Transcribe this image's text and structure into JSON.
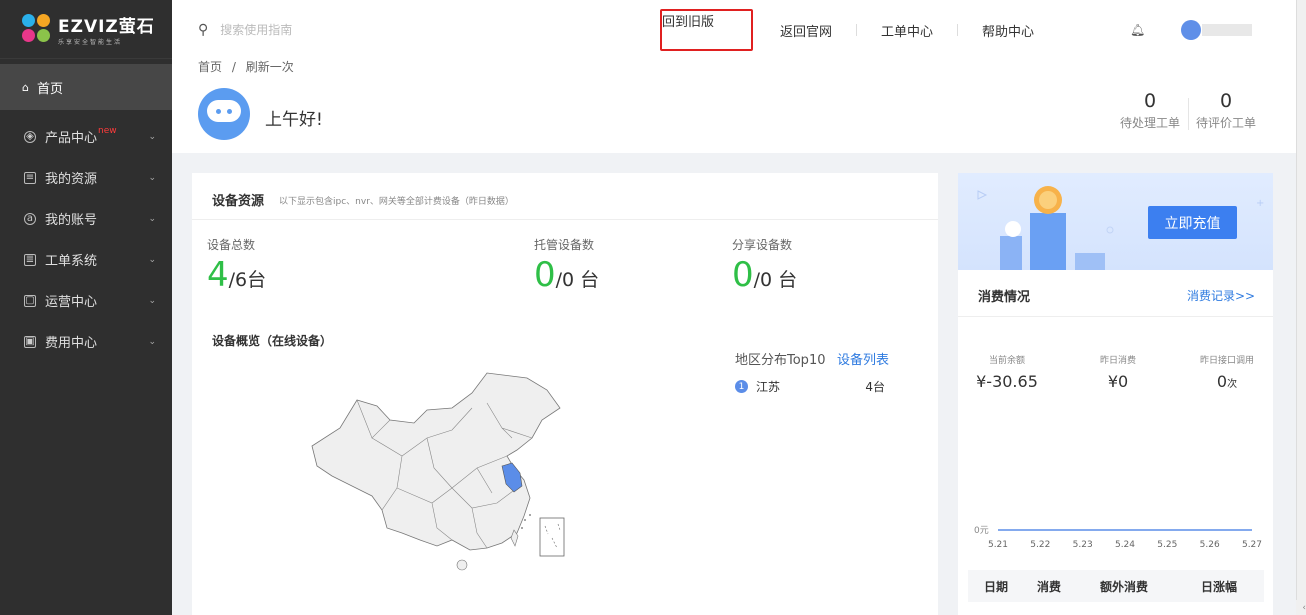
{
  "logo": {
    "brand": "EZVIZ萤石",
    "slogan": "乐享安全智能生活"
  },
  "sidebar": {
    "home_label": "首页",
    "items": [
      {
        "label": "产品中心",
        "badge": "new",
        "icon": "box-icon"
      },
      {
        "label": "我的资源",
        "icon": "file-icon"
      },
      {
        "label": "我的账号",
        "icon": "account-icon"
      },
      {
        "label": "工单系统",
        "icon": "ticket-icon"
      },
      {
        "label": "运营中心",
        "icon": "operation-icon"
      },
      {
        "label": "费用中心",
        "icon": "fee-icon"
      }
    ]
  },
  "topbar": {
    "search_placeholder": "搜索使用指南",
    "old_version": "回到旧版",
    "official_site": "返回官网",
    "ticket_center": "工单中心",
    "help_center": "帮助中心"
  },
  "breadcrumb": {
    "home": "首页",
    "sep": "/",
    "current": "刷新一次"
  },
  "greeting": "上午好!",
  "tickets": {
    "pending_count": "0",
    "pending_label": "待处理工单",
    "review_count": "0",
    "review_label": "待评价工单"
  },
  "device": {
    "title": "设备资源",
    "subtitle": "以下显示包含ipc、nvr、网关等全部计费设备（昨日数据）",
    "total_label": "设备总数",
    "total_value": "4",
    "total_suffix": "/6台",
    "hosted_label": "托管设备数",
    "hosted_value": "0",
    "hosted_suffix": "/0 台",
    "shared_label": "分享设备数",
    "shared_value": "0",
    "shared_suffix": "/0 台",
    "overview_title": "设备概览（在线设备）",
    "region_title": "地区分布Top10",
    "device_list_link": "设备列表",
    "regions": [
      {
        "rank": "1",
        "name": "江苏",
        "count": "4台"
      }
    ]
  },
  "billing": {
    "recharge": "立即充值",
    "title": "消费情况",
    "records_link": "消费记录>>",
    "balance_label": "当前余额",
    "balance_value": "¥-30.65",
    "yesterday_label": "昨日消费",
    "yesterday_value": "¥0",
    "api_label": "昨日接口调用",
    "api_value": "0",
    "api_unit": "次",
    "table_headers": [
      "日期",
      "消费",
      "额外消费",
      "日涨幅"
    ]
  },
  "chart_data": {
    "type": "line",
    "x": [
      "5.21",
      "5.22",
      "5.23",
      "5.24",
      "5.25",
      "5.26",
      "5.27"
    ],
    "series": [
      {
        "values": [
          0,
          0,
          0,
          0,
          0,
          0,
          0
        ]
      }
    ],
    "ytick_labels": [
      "0元"
    ],
    "color": "#5b8de8"
  },
  "colors": {
    "accent": "#3c7ff0",
    "success": "#2fbf47",
    "highlight_border": "#e02020",
    "sidebar": "#2f2f2f"
  }
}
